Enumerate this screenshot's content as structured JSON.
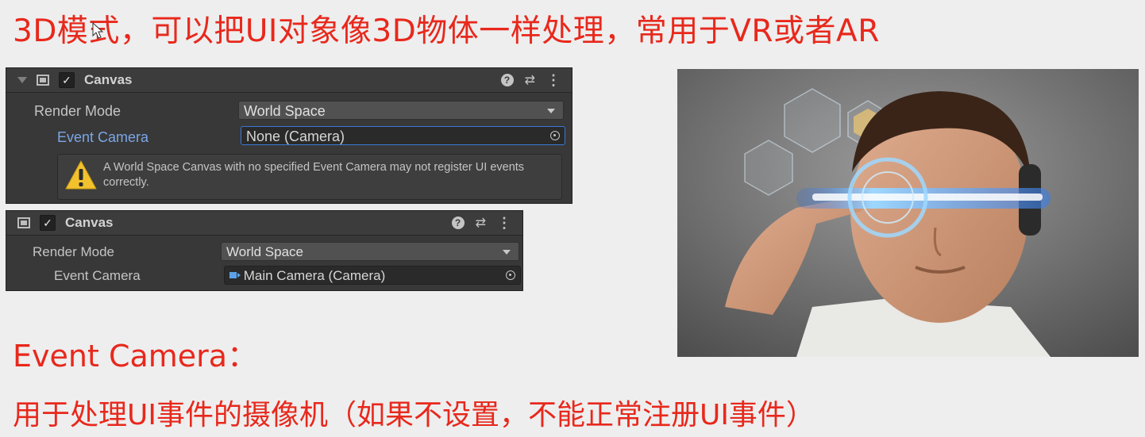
{
  "slide": {
    "title": "3D模式，可以把UI对象像3D物体一样处理，常用于VR或者AR",
    "caption_heading": "Event Camera：",
    "caption_body": "用于处理UI事件的摄像机（如果不设置，不能正常注册UI事件）"
  },
  "inspector_top": {
    "component_title": "Canvas",
    "render_mode_label": "Render Mode",
    "render_mode_value": "World Space",
    "event_camera_label": "Event Camera",
    "event_camera_value": "None (Camera)",
    "warning_text": "A World Space Canvas with no specified Event Camera may not register UI events correctly."
  },
  "inspector_bottom": {
    "component_title": "Canvas",
    "render_mode_label": "Render Mode",
    "render_mode_value": "World Space",
    "event_camera_label": "Event Camera",
    "event_camera_value": "Main Camera (Camera)"
  },
  "icons": {
    "help": "?",
    "checkbox": "✓",
    "sliders": "⇄",
    "kebab": "⋮"
  },
  "colors": {
    "accent_red": "#e8281c",
    "focus_blue": "#7ba6e6",
    "warning_yellow": "#f2c12e",
    "panel_bg": "#383838"
  }
}
